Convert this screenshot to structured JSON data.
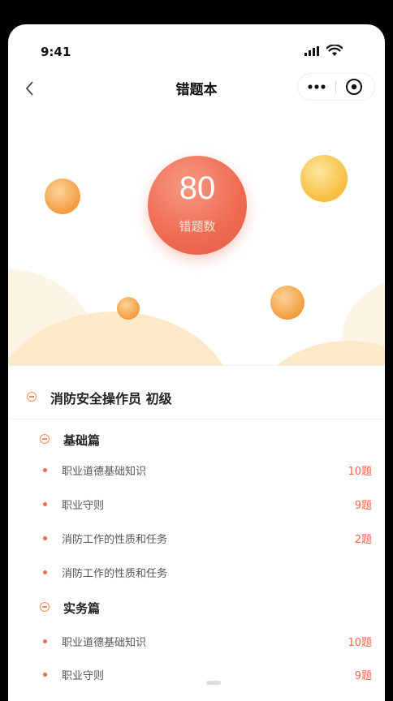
{
  "status_bar": {
    "time": "9:41"
  },
  "nav": {
    "title": "错题本"
  },
  "hero": {
    "wrong_count": "80",
    "wrong_label": "错题数"
  },
  "course": {
    "title": "消防安全操作员 初级"
  },
  "sections": [
    {
      "title": "基础篇",
      "items": [
        {
          "label": "职业道德基础知识",
          "count": "10题"
        },
        {
          "label": "职业守则",
          "count": "9题"
        },
        {
          "label": "消防工作的性质和任务",
          "count": "2题"
        },
        {
          "label": "消防工作的性质和任务",
          "count": ""
        }
      ]
    },
    {
      "title": "实务篇",
      "items": [
        {
          "label": "职业道德基础知识",
          "count": "10题"
        },
        {
          "label": "职业守则",
          "count": "9题"
        }
      ]
    }
  ],
  "colors": {
    "accent": "#f06a4a",
    "ball_orange": "#f7a64a",
    "ball_yellow": "#fbc94f",
    "hill": "#fdf0db"
  }
}
